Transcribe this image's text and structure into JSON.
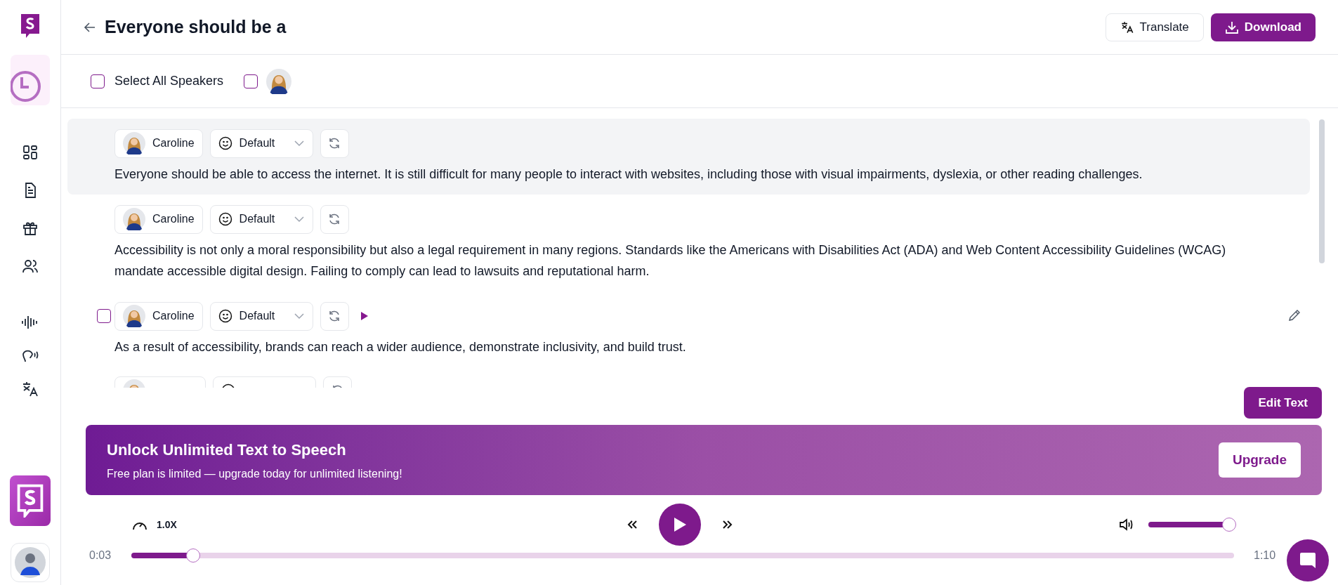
{
  "header": {
    "title": "Everyone should be a",
    "buttons": [
      {
        "label": "Translate",
        "kind": "outline"
      },
      {
        "label": "Download",
        "kind": "primary"
      }
    ]
  },
  "speaker_filter": {
    "select_all": {
      "label": "Select All Speakers",
      "checked": false
    },
    "speakers": [
      {
        "checked": false
      }
    ]
  },
  "segments": [
    {
      "speaker": "Caroline",
      "style": "Default",
      "text": "Everyone should be able to access the internet. It is still difficult for many people to interact with websites, including those with visual impairments, dyslexia, or other reading challenges.",
      "selected": true
    },
    {
      "speaker": "Caroline",
      "style": "Default",
      "text": "Accessibility is not only a moral responsibility but also a legal requirement in many regions. Standards like the Americans with Disabilities Act (ADA) and Web Content Accessibility Guidelines (WCAG) mandate accessible digital design. Failing to comply can lead to lawsuits and reputational harm.",
      "selected": false
    },
    {
      "speaker": "Caroline",
      "style": "Default",
      "text": "As a result of accessibility, brands can reach a wider audience, demonstrate inclusivity, and build trust.",
      "selected": false,
      "checked": false
    }
  ],
  "edit_button": "Edit Text",
  "banner": {
    "title": "Unlock Unlimited Text to Speech",
    "subtitle": "Free plan is limited — upgrade today for unlimited listening!",
    "button": "Upgrade"
  },
  "player": {
    "speed": "1.0X",
    "volume": {
      "level": 1
    },
    "progress": {
      "level": 0.056
    },
    "elapsed": "0:03",
    "duration": "1:10"
  }
}
